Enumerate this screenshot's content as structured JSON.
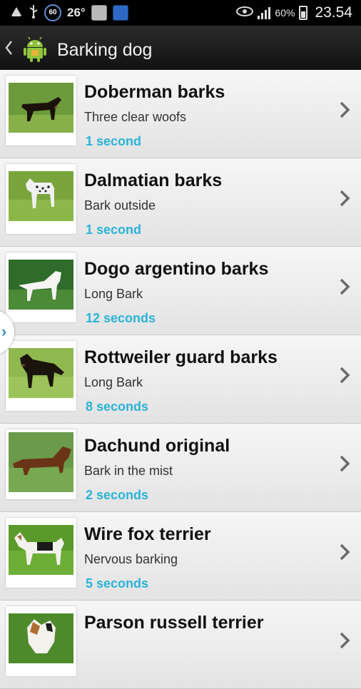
{
  "status_bar": {
    "ring_value": "60",
    "temperature": "26°",
    "battery": "60%",
    "time": "23.54",
    "icons": [
      "android-debug-icon",
      "usb-icon",
      "ring-60-icon",
      "temperature-text",
      "settings-app-icon",
      "gift-app-icon",
      "eye-icon",
      "signal-icon",
      "battery-icon"
    ]
  },
  "action_bar": {
    "title": "Barking dog",
    "back_icon": "chevron-left-icon",
    "logo_icon": "android-icon"
  },
  "items": [
    {
      "title": "Doberman barks",
      "subtitle": "Three clear woofs",
      "duration": "1 second"
    },
    {
      "title": "Dalmatian barks",
      "subtitle": "Bark outside",
      "duration": "1 second"
    },
    {
      "title": "Dogo argentino barks",
      "subtitle": "Long Bark",
      "duration": "12 seconds"
    },
    {
      "title": "Rottweiler guard barks",
      "subtitle": "Long Bark",
      "duration": "8 seconds"
    },
    {
      "title": "Dachund original",
      "subtitle": "Bark in the mist",
      "duration": "2 seconds"
    },
    {
      "title": "Wire fox terrier",
      "subtitle": "Nervous barking",
      "duration": "5 seconds"
    },
    {
      "title": "Parson russell terrier",
      "subtitle": "",
      "duration": ""
    }
  ],
  "colors": {
    "accent": "#2ab3d8",
    "action_bar": "#1a1a1a"
  }
}
